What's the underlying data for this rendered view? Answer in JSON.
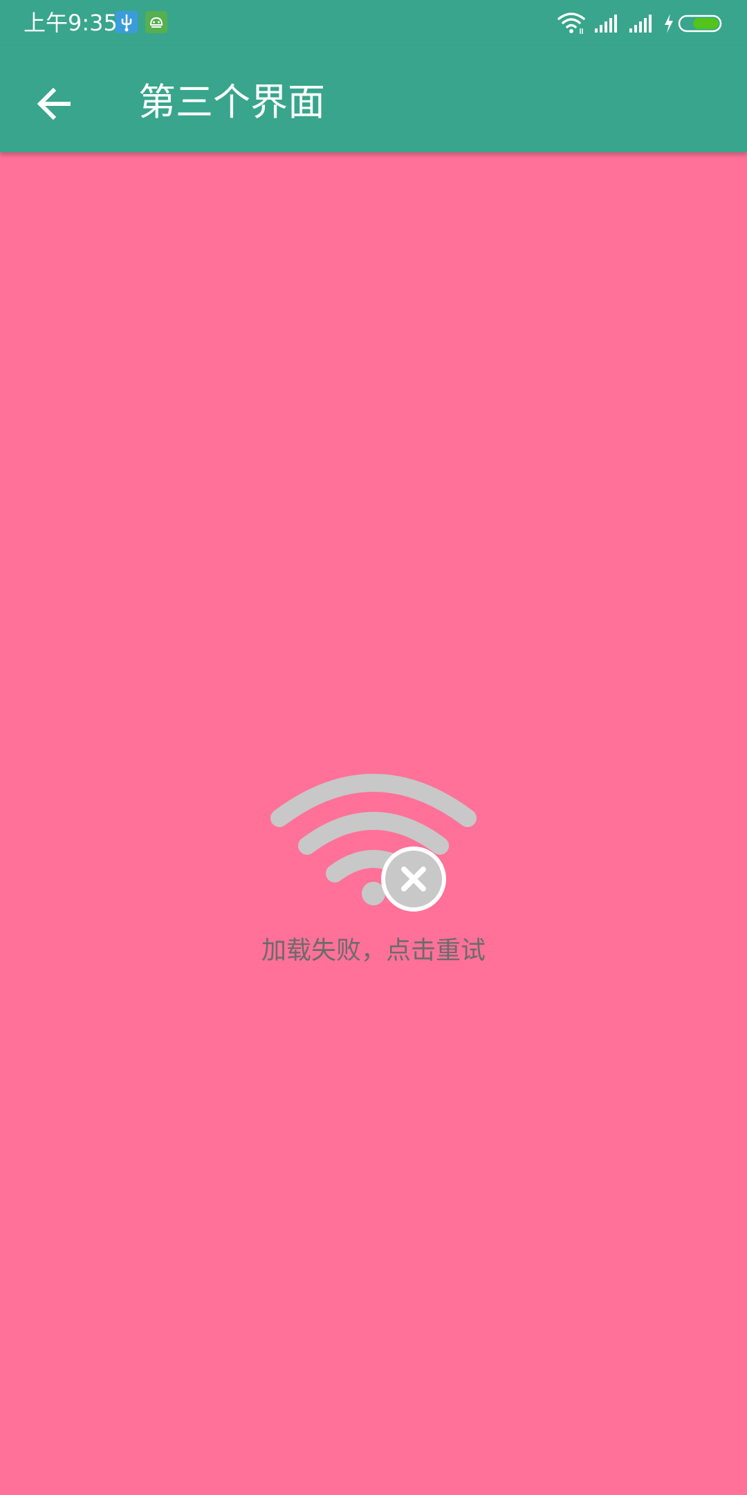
{
  "status_bar": {
    "time": "上午9:35",
    "notification_icons": [
      "usb-icon",
      "android-icon"
    ],
    "indicators": [
      "wifi-icon",
      "cellular-signal-icon",
      "cellular-signal-icon",
      "charging-icon",
      "battery-icon"
    ],
    "battery_color": "#52c41a"
  },
  "app_bar": {
    "title": "第三个界面",
    "back_icon": "arrow-back-icon",
    "background_color": "#38a58c"
  },
  "content": {
    "background_color": "#ff7199",
    "error_icon": "wifi-off-icon",
    "retry_text": "加载失败，点击重试"
  }
}
